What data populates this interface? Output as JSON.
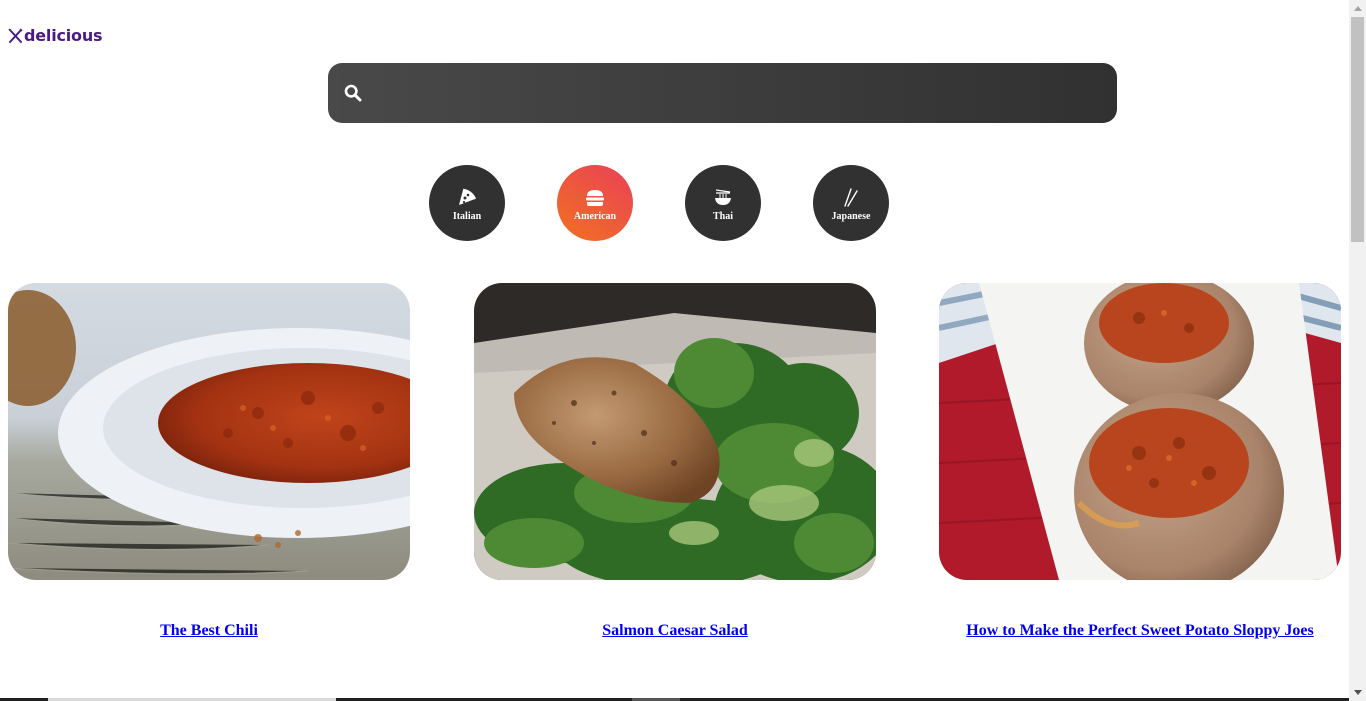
{
  "brand": {
    "name": "delicious"
  },
  "search": {
    "placeholder": "",
    "value": ""
  },
  "categories": [
    {
      "label": "Italian",
      "icon": "pizza-icon",
      "active": false
    },
    {
      "label": "American",
      "icon": "burger-icon",
      "active": true
    },
    {
      "label": "Thai",
      "icon": "noodle-bowl-icon",
      "active": false
    },
    {
      "label": "Japanese",
      "icon": "chopsticks-icon",
      "active": false
    }
  ],
  "recipes": [
    {
      "title": "The Best Chili",
      "image": "chili-bowl-photo"
    },
    {
      "title": "Salmon Caesar Salad",
      "image": "salmon-caesar-salad-photo"
    },
    {
      "title": "How to Make the Perfect Sweet Potato Sloppy Joes",
      "image": "sweet-potato-sloppy-joes-photo"
    }
  ],
  "colors": {
    "brand": "#4b1a86",
    "search_bg": "#3a3a3a",
    "category_bg": "#313131",
    "category_active_from": "#f27121",
    "category_active_to": "#e94057",
    "link": "#0000ee"
  }
}
